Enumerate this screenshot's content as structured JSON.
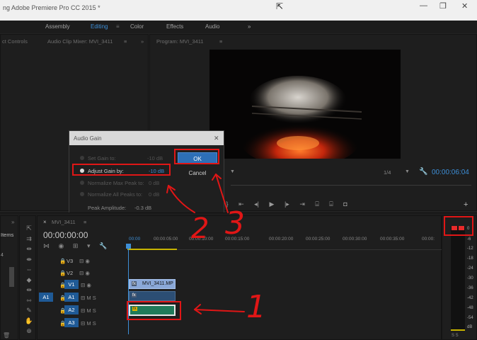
{
  "window": {
    "title": "ng Adobe Premiere Pro CC 2015 *",
    "min": "—",
    "max": "❐",
    "close": "✕"
  },
  "workspaces": [
    "Assembly",
    "Editing",
    "Color",
    "Effects",
    "Audio"
  ],
  "workspace_more": "»",
  "workspace_menu": "≡",
  "left_panel": {
    "tab1": "ct Controls",
    "tab2": "Audio Clip Mixer: MVI_3411",
    "menu": "≡",
    "more": "»"
  },
  "program": {
    "tab": "Program: MVI_3411",
    "menu": "≡",
    "zoom": "1/4",
    "timecode": "00:00:06:04",
    "add": "+"
  },
  "dialog": {
    "title": "Audio Gain",
    "close": "✕",
    "options": [
      {
        "label": "Set Gain to:",
        "value": "-10 dB",
        "selected": false
      },
      {
        "label": "Adjust Gain by:",
        "value": "-10 dB",
        "selected": true
      },
      {
        "label": "Normalize Max Peak to:",
        "value": "0 dB",
        "selected": false
      },
      {
        "label": "Normalize All Peaks to:",
        "value": "0 dB",
        "selected": false
      }
    ],
    "peak_label": "Peak Amplitude:",
    "peak_value": "-0.3 dB",
    "ok": "OK",
    "cancel": "Cancel"
  },
  "project": {
    "tab": "Items",
    "more": "»",
    "count": "4"
  },
  "sequence": {
    "tab": "MVI_3411",
    "menu": "≡",
    "timecode": "00:00:00:00",
    "ruler": [
      "00:00",
      "00:00:05:00",
      "00:00:10:00",
      "00:00:15:00",
      "00:00:20:00",
      "00:00:25:00",
      "00:00:30:00",
      "00:00:35:00",
      "00:00:"
    ],
    "tracks": [
      {
        "name": "V3",
        "lock": "🔒",
        "icons": "⊟ ◉"
      },
      {
        "name": "V2",
        "lock": "🔒",
        "icons": "⊟ ◉"
      },
      {
        "name": "V1",
        "lock": "🔒",
        "icons": "⊟ ◉"
      },
      {
        "name": "A1",
        "lock": "🔒",
        "icons": "⊟ M S",
        "src": "A1"
      },
      {
        "name": "A2",
        "lock": "🔒",
        "icons": "⊟ M S"
      },
      {
        "name": "A3",
        "lock": "🔒",
        "icons": "⊟ M S"
      }
    ],
    "video_clip": "MVI_3411.MP",
    "fx": "fx"
  },
  "meter": {
    "labels": [
      "0",
      "-6",
      "-12",
      "-18",
      "-24",
      "-30",
      "-36",
      "-42",
      "-48",
      "-54",
      "dB"
    ],
    "solo": "S S"
  },
  "annotations": [
    "1",
    "2",
    "3"
  ],
  "colors": {
    "accent": "#3d8ed6",
    "annotation": "#e01616",
    "audio_clip": "#1f7a5a",
    "video_clip": "#8aa8d8"
  }
}
